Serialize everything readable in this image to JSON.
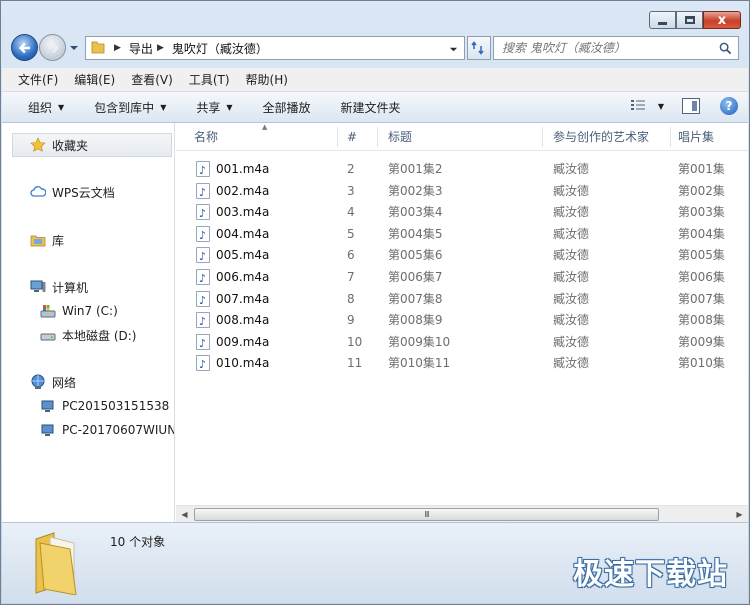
{
  "window": {
    "caption_buttons": {
      "close_glyph": "x"
    }
  },
  "nav": {
    "breadcrumb": [
      "导出",
      "鬼吹灯（臧汝德）"
    ],
    "search_placeholder": "搜索 鬼吹灯（臧汝德）"
  },
  "menubar": {
    "items": [
      "文件(F)",
      "编辑(E)",
      "查看(V)",
      "工具(T)",
      "帮助(H)"
    ]
  },
  "cmdbar": {
    "items": [
      "组织",
      "包含到库中",
      "共享",
      "全部播放",
      "新建文件夹"
    ]
  },
  "tree": {
    "favorites": "收藏夹",
    "wps": "WPS云文档",
    "library": "库",
    "computer": "计算机",
    "drive_c": "Win7 (C:)",
    "drive_d": "本地磁盘 (D:)",
    "network": "网络",
    "pc1": "PC201503151538",
    "pc2": "PC-20170607WIUN"
  },
  "columns": [
    "名称",
    "#",
    "标题",
    "参与创作的艺术家",
    "唱片集"
  ],
  "files": [
    {
      "name": "001.m4a",
      "num": "2",
      "title": "第001集2",
      "artist": "臧汝德",
      "album": "第001集"
    },
    {
      "name": "002.m4a",
      "num": "3",
      "title": "第002集3",
      "artist": "臧汝德",
      "album": "第002集"
    },
    {
      "name": "003.m4a",
      "num": "4",
      "title": "第003集4",
      "artist": "臧汝德",
      "album": "第003集"
    },
    {
      "name": "004.m4a",
      "num": "5",
      "title": "第004集5",
      "artist": "臧汝德",
      "album": "第004集"
    },
    {
      "name": "005.m4a",
      "num": "6",
      "title": "第005集6",
      "artist": "臧汝德",
      "album": "第005集"
    },
    {
      "name": "006.m4a",
      "num": "7",
      "title": "第006集7",
      "artist": "臧汝德",
      "album": "第006集"
    },
    {
      "name": "007.m4a",
      "num": "8",
      "title": "第007集8",
      "artist": "臧汝德",
      "album": "第007集"
    },
    {
      "name": "008.m4a",
      "num": "9",
      "title": "第008集9",
      "artist": "臧汝德",
      "album": "第008集"
    },
    {
      "name": "009.m4a",
      "num": "10",
      "title": "第009集10",
      "artist": "臧汝德",
      "album": "第009集"
    },
    {
      "name": "010.m4a",
      "num": "11",
      "title": "第010集11",
      "artist": "臧汝德",
      "album": "第010集"
    }
  ],
  "scroll_thumb_grip": "III",
  "details": {
    "count": "10 个对象"
  },
  "watermark": "极速下载站"
}
